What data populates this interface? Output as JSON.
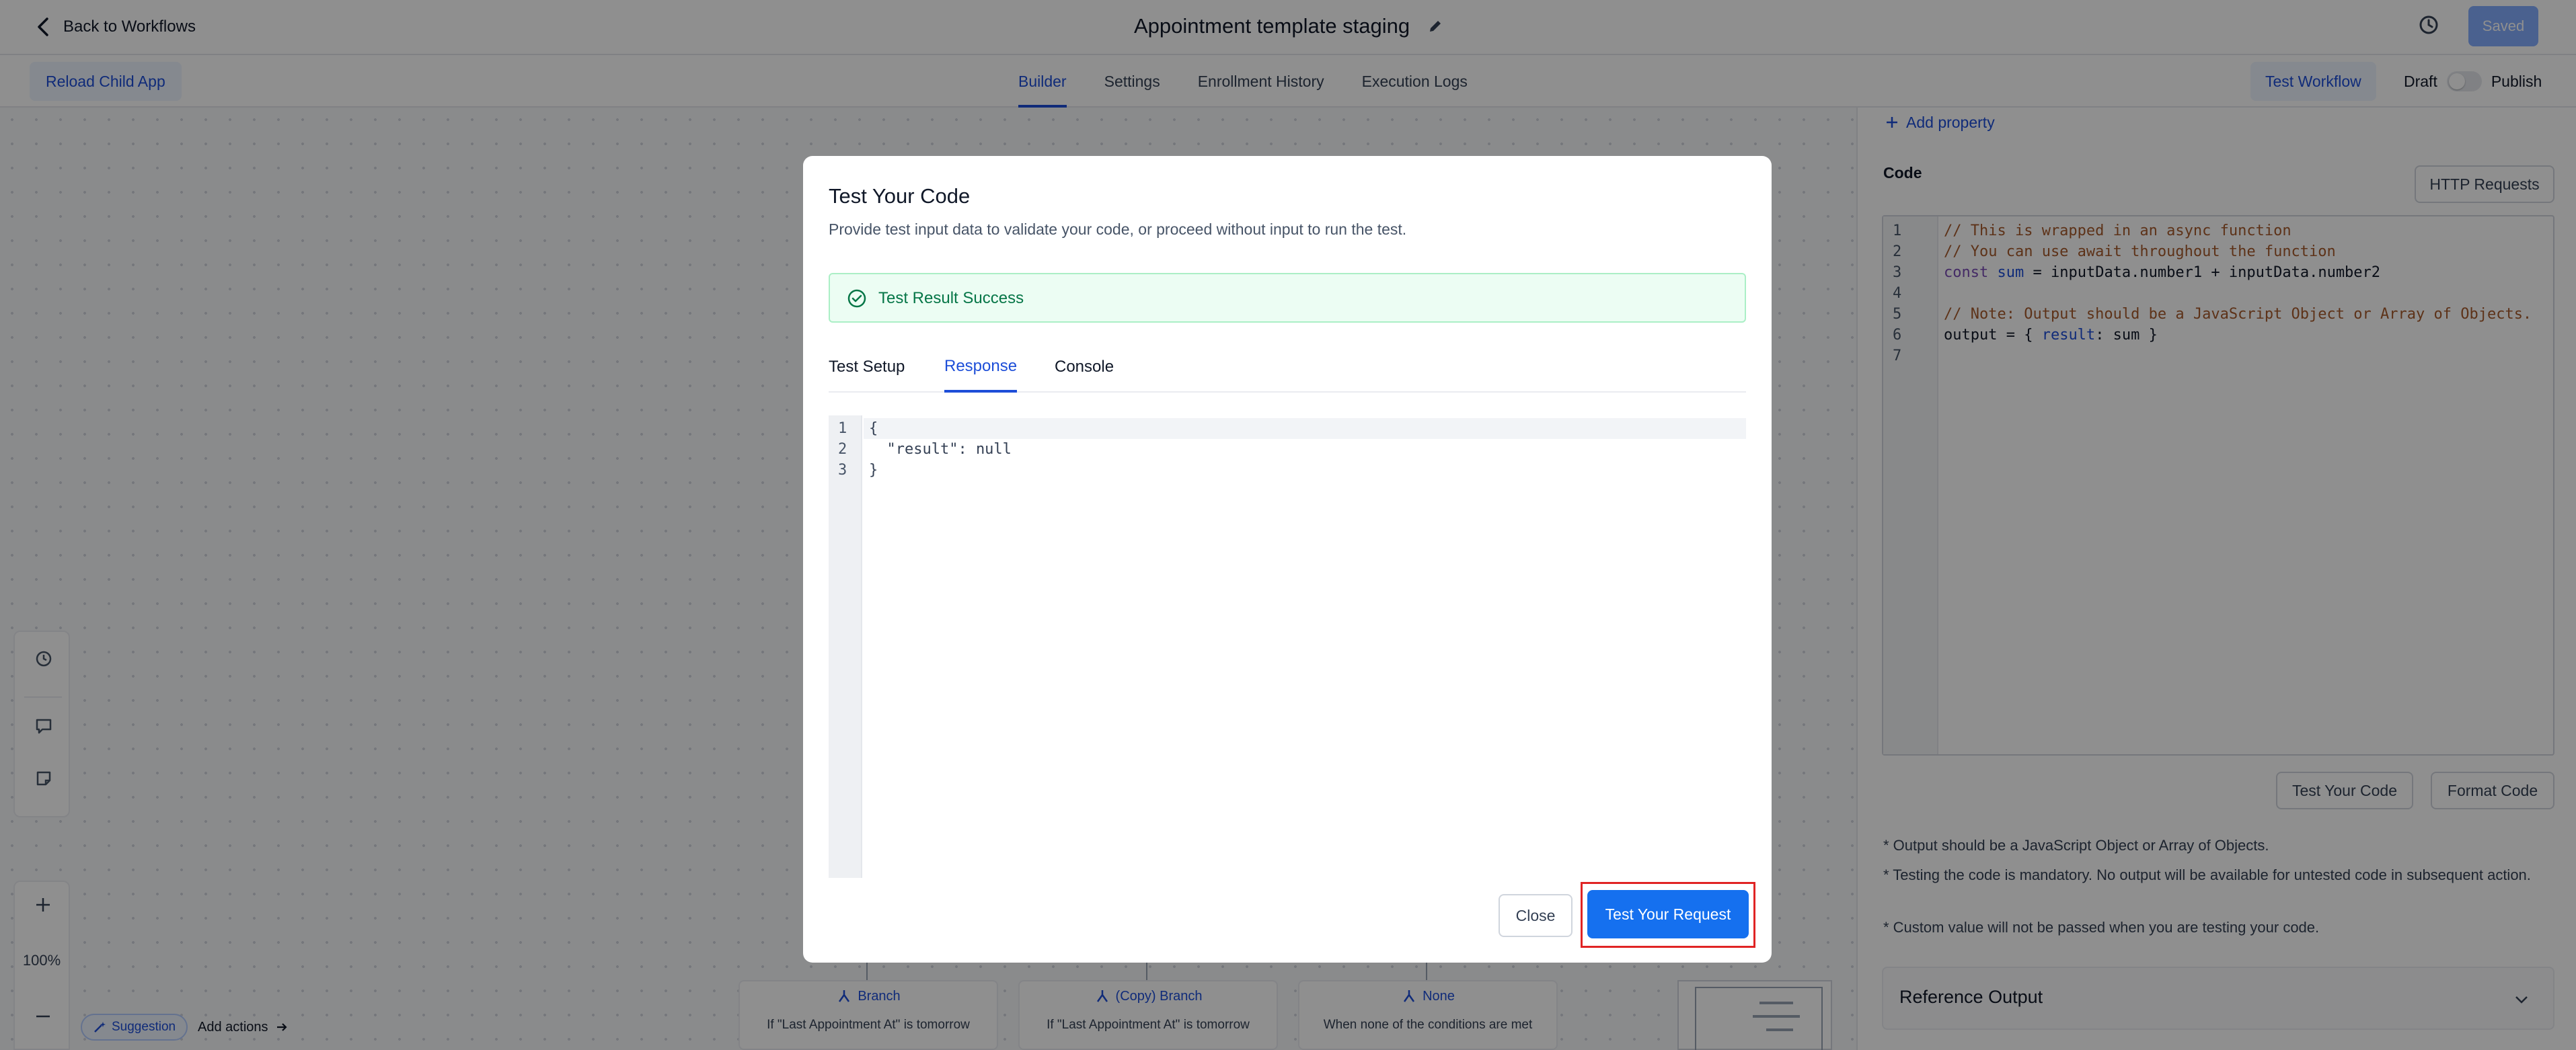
{
  "topbar": {
    "back_label": "Back to Workflows",
    "title": "Appointment template staging",
    "saved_label": "Saved"
  },
  "subbar": {
    "reload_label": "Reload Child App",
    "tabs": [
      {
        "label": "Builder",
        "active": true
      },
      {
        "label": "Settings",
        "active": false
      },
      {
        "label": "Enrollment History",
        "active": false
      },
      {
        "label": "Execution Logs",
        "active": false
      }
    ],
    "test_workflow_label": "Test Workflow",
    "draft_label": "Draft",
    "publish_label": "Publish",
    "publish_on": false
  },
  "canvas": {
    "zoom_level": "100%",
    "suggestion_label": "Suggestion",
    "add_actions_label": "Add actions",
    "branches": [
      {
        "title": "Branch",
        "subtitle": "If \"Last Appointment At\" is tomorrow"
      },
      {
        "title": "(Copy) Branch",
        "subtitle": "If \"Last Appointment At\" is tomorrow"
      },
      {
        "title": "None",
        "subtitle": "When none of the conditions are met"
      }
    ]
  },
  "right_panel": {
    "add_property_label": "Add property",
    "code_label": "Code",
    "http_requests_label": "HTTP Requests",
    "code_lines": [
      "// This is wrapped in an async function",
      "// You can use await throughout the function",
      "const sum = inputData.number1 + inputData.number2",
      "",
      "// Note: Output should be a JavaScript Object or Array of Objects.",
      "output = { result: sum }",
      ""
    ],
    "test_code_label": "Test Your Code",
    "format_code_label": "Format Code",
    "notes": [
      "* Output should be a JavaScript Object or Array of Objects.",
      "* Testing the code is mandatory. No output will be available for untested code in subsequent action.",
      "* Custom value will not be passed when you are testing your code."
    ],
    "reference_output_label": "Reference Output"
  },
  "modal": {
    "title": "Test Your Code",
    "description": "Provide test input data to validate your code, or proceed without input to run the test.",
    "success_message": "Test Result Success",
    "tabs": [
      {
        "label": "Test Setup",
        "active": false
      },
      {
        "label": "Response",
        "active": true
      },
      {
        "label": "Console",
        "active": false
      }
    ],
    "response_lines": [
      "{",
      "  \"result\": null",
      "}"
    ],
    "close_label": "Close",
    "test_request_label": "Test Your Request"
  },
  "colors": {
    "accent": "#1d4ed8",
    "primary_button": "#1570ef",
    "success_text": "#067647",
    "success_bg": "#ecfdf3",
    "highlight_border": "#e02424"
  },
  "icons": {
    "back": "chevron-left-icon",
    "edit": "pencil-icon",
    "history": "history-icon",
    "success": "check-circle-icon",
    "branch": "branch-icon",
    "chevron": "chevron-down-icon"
  }
}
